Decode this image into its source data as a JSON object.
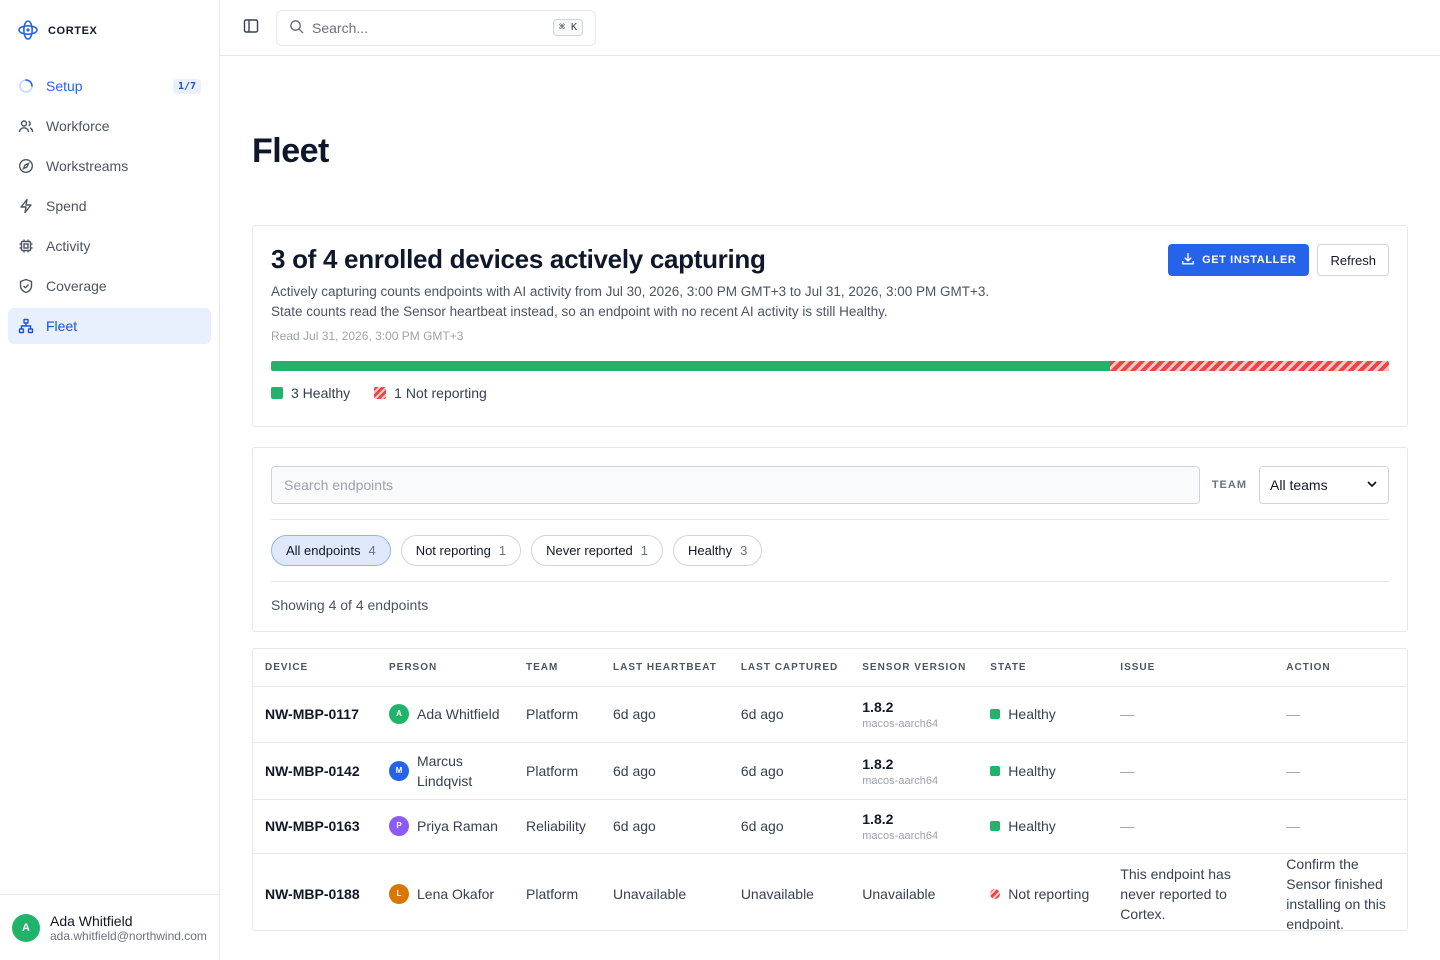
{
  "brand": {
    "name": "CORTEX"
  },
  "sidebar": {
    "items": [
      {
        "label": "Setup",
        "badge": "1/7",
        "icon": "spinner-icon"
      },
      {
        "label": "Workforce",
        "icon": "users-icon"
      },
      {
        "label": "Workstreams",
        "icon": "compass-icon"
      },
      {
        "label": "Spend",
        "icon": "lightning-icon"
      },
      {
        "label": "Activity",
        "icon": "chip-icon"
      },
      {
        "label": "Coverage",
        "icon": "shield-icon"
      },
      {
        "label": "Fleet",
        "icon": "network-icon"
      }
    ],
    "active": "Fleet"
  },
  "user": {
    "initial": "A",
    "name": "Ada Whitfield",
    "email": "ada.whitfield@northwind.com"
  },
  "topbar": {
    "search_placeholder": "Search...",
    "shortcut": "⌘ K"
  },
  "page": {
    "title": "Fleet"
  },
  "summary": {
    "title": "3 of 4 enrolled devices actively capturing",
    "desc_line1": "Actively capturing counts endpoints with AI activity from Jul 30, 2026, 3:00 PM GMT+3 to Jul 31, 2026, 3:00 PM GMT+3.",
    "desc_line2": "State counts read the Sensor heartbeat instead, so an endpoint with no recent AI activity is still Healthy.",
    "read_at": "Read Jul 31, 2026, 3:00 PM GMT+3",
    "get_installer_label": "GET INSTALLER",
    "refresh_label": "Refresh",
    "healthy_count": 3,
    "not_reporting_count": 1,
    "legend_healthy": "3 Healthy",
    "legend_not_reporting": "1 Not reporting",
    "colors": {
      "healthy": "#22b36a",
      "not_reporting": "#ef4444",
      "accent": "#2563eb"
    }
  },
  "filters": {
    "search_placeholder": "Search endpoints",
    "team_label": "TEAM",
    "team_value": "All teams",
    "chips": [
      {
        "label": "All endpoints",
        "count": "4",
        "active": true
      },
      {
        "label": "Not reporting",
        "count": "1"
      },
      {
        "label": "Never reported",
        "count": "1"
      },
      {
        "label": "Healthy",
        "count": "3"
      }
    ],
    "showing": "Showing 4 of 4 endpoints"
  },
  "table": {
    "headers": [
      "DEVICE",
      "PERSON",
      "TEAM",
      "LAST HEARTBEAT",
      "LAST CAPTURED",
      "SENSOR VERSION",
      "STATE",
      "ISSUE",
      "ACTION"
    ],
    "rows": [
      {
        "device": "NW-MBP-0117",
        "initial": "A",
        "avatar_color": "#22b36a",
        "person": "Ada Whitfield",
        "team": "Platform",
        "heartbeat": "6d ago",
        "captured": "6d ago",
        "version": "1.8.2",
        "platform": "macos-aarch64",
        "state": "Healthy",
        "issue": "—",
        "action": "—"
      },
      {
        "device": "NW-MBP-0142",
        "initial": "M",
        "avatar_color": "#2563eb",
        "person": "Marcus Lindqvist",
        "team": "Platform",
        "heartbeat": "6d ago",
        "captured": "6d ago",
        "version": "1.8.2",
        "platform": "macos-aarch64",
        "state": "Healthy",
        "issue": "—",
        "action": "—"
      },
      {
        "device": "NW-MBP-0163",
        "initial": "P",
        "avatar_color": "#8b5cf6",
        "person": "Priya Raman",
        "team": "Reliability",
        "heartbeat": "6d ago",
        "captured": "6d ago",
        "version": "1.8.2",
        "platform": "macos-aarch64",
        "state": "Healthy",
        "issue": "—",
        "action": "—"
      },
      {
        "device": "NW-MBP-0188",
        "initial": "L",
        "avatar_color": "#d97706",
        "person": "Lena Okafor",
        "team": "Platform",
        "heartbeat": "Unavailable",
        "captured": "Unavailable",
        "version": "Unavailable",
        "platform": "",
        "state": "Not reporting",
        "issue": "This endpoint has never reported to Cortex.",
        "action": "Confirm the Sensor finished installing on this endpoint."
      }
    ]
  }
}
